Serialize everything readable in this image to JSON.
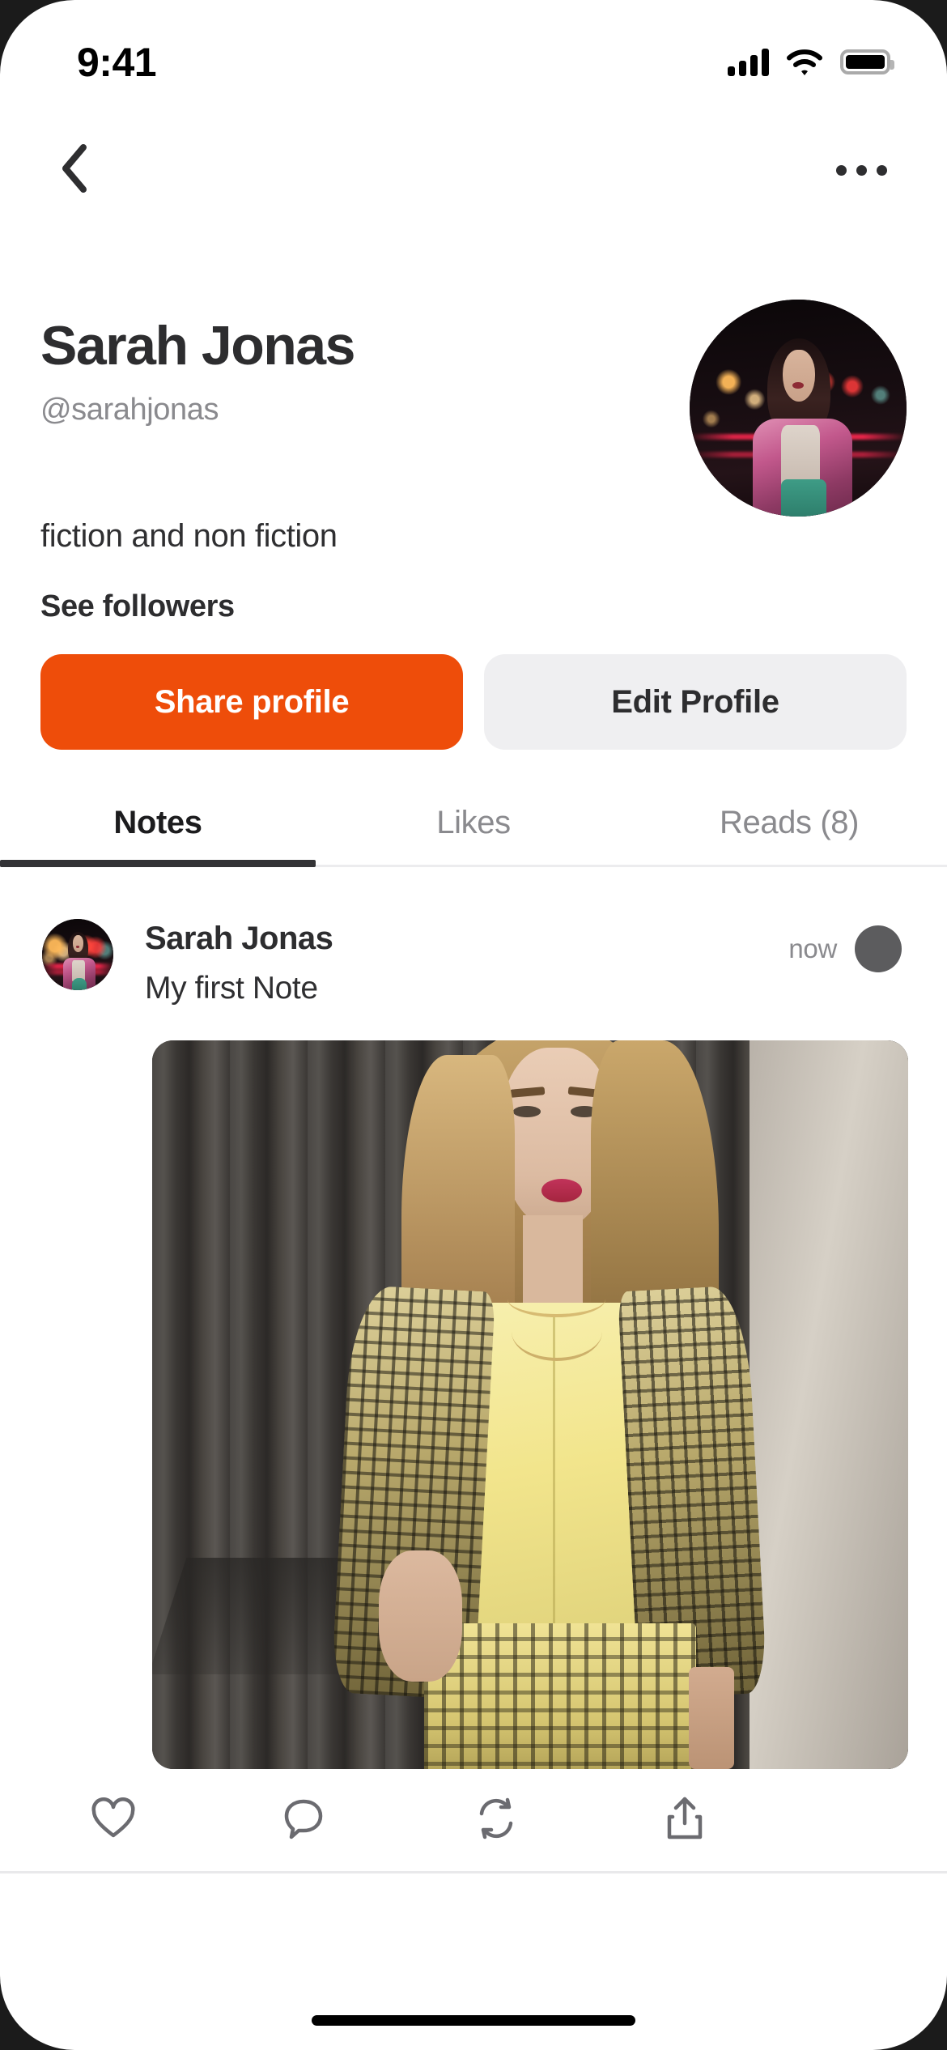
{
  "status_bar": {
    "time": "9:41",
    "icons": [
      "signal-icon",
      "wifi-icon",
      "battery-icon"
    ]
  },
  "nav_bar": {
    "back_icon": "chevron-left-icon",
    "more_icon": "ellipsis-icon"
  },
  "profile": {
    "display_name": "Sarah Jonas",
    "handle": "@sarahjonas",
    "bio": "fiction and non fiction",
    "followers_link": "See followers",
    "avatar_alt": "night-street-portrait"
  },
  "actions": {
    "share_label": "Share profile",
    "edit_label": "Edit Profile",
    "primary_color": "#ee4d0a",
    "secondary_color": "#efeff1"
  },
  "tabs": [
    {
      "label": "Notes",
      "active": true
    },
    {
      "label": "Likes",
      "active": false
    },
    {
      "label": "Reads (8)",
      "active": false
    }
  ],
  "post": {
    "author": "Sarah Jonas",
    "text": "My first Note",
    "timestamp": "now",
    "image_alt": "blonde-woman-yellow-blouse-plaid-blazer",
    "actions": [
      {
        "name": "like-icon",
        "label": "Like"
      },
      {
        "name": "comment-icon",
        "label": "Comment"
      },
      {
        "name": "repost-icon",
        "label": "Repost"
      },
      {
        "name": "share-icon",
        "label": "Share"
      }
    ]
  }
}
